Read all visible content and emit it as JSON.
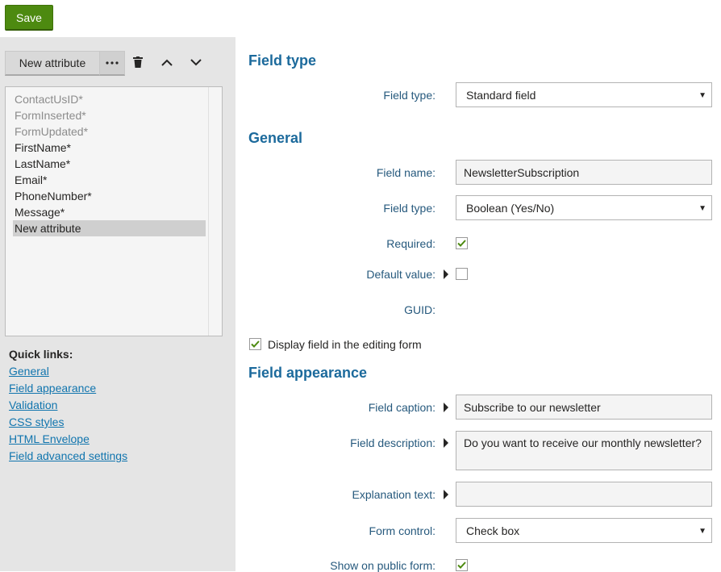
{
  "toolbar": {
    "save_label": "Save"
  },
  "left": {
    "new_attribute_label": "New attribute",
    "more_label": "···",
    "items": [
      {
        "label": "ContactUsID*",
        "state": "system"
      },
      {
        "label": "FormInserted*",
        "state": "system"
      },
      {
        "label": "FormUpdated*",
        "state": "system"
      },
      {
        "label": "FirstName*",
        "state": "normal"
      },
      {
        "label": "LastName*",
        "state": "normal"
      },
      {
        "label": "Email*",
        "state": "normal"
      },
      {
        "label": "PhoneNumber*",
        "state": "normal"
      },
      {
        "label": "Message*",
        "state": "normal"
      },
      {
        "label": "New attribute",
        "state": "selected"
      }
    ],
    "quick_links_title": "Quick links:",
    "quick_links": [
      "General",
      "Field appearance",
      "Validation",
      "CSS styles",
      "HTML Envelope",
      "Field advanced settings"
    ]
  },
  "main": {
    "field_type_section": "Field type",
    "field_type_label": "Field type:",
    "field_type_value": "Standard field",
    "general_section": "General",
    "field_name_label": "Field name:",
    "field_name_value": "NewsletterSubscription",
    "data_type_label": "Field type:",
    "data_type_value": "Boolean (Yes/No)",
    "required_label": "Required:",
    "required_checked": true,
    "default_value_label": "Default value:",
    "default_value_checked": false,
    "guid_label": "GUID:",
    "display_field_label": "Display field in the editing form",
    "display_field_checked": true,
    "appearance_section": "Field appearance",
    "caption_label": "Field caption:",
    "caption_value": "Subscribe to our newsletter",
    "description_label": "Field description:",
    "description_value": "Do you want to receive our monthly newsletter?",
    "explanation_label": "Explanation text:",
    "explanation_value": "",
    "form_control_label": "Form control:",
    "form_control_value": "Check box",
    "public_form_label": "Show on public form:",
    "public_form_checked": true
  },
  "colors": {
    "accent": "#1c6a9c",
    "save_green": "#4d8a10",
    "check_green": "#4d8a10"
  }
}
